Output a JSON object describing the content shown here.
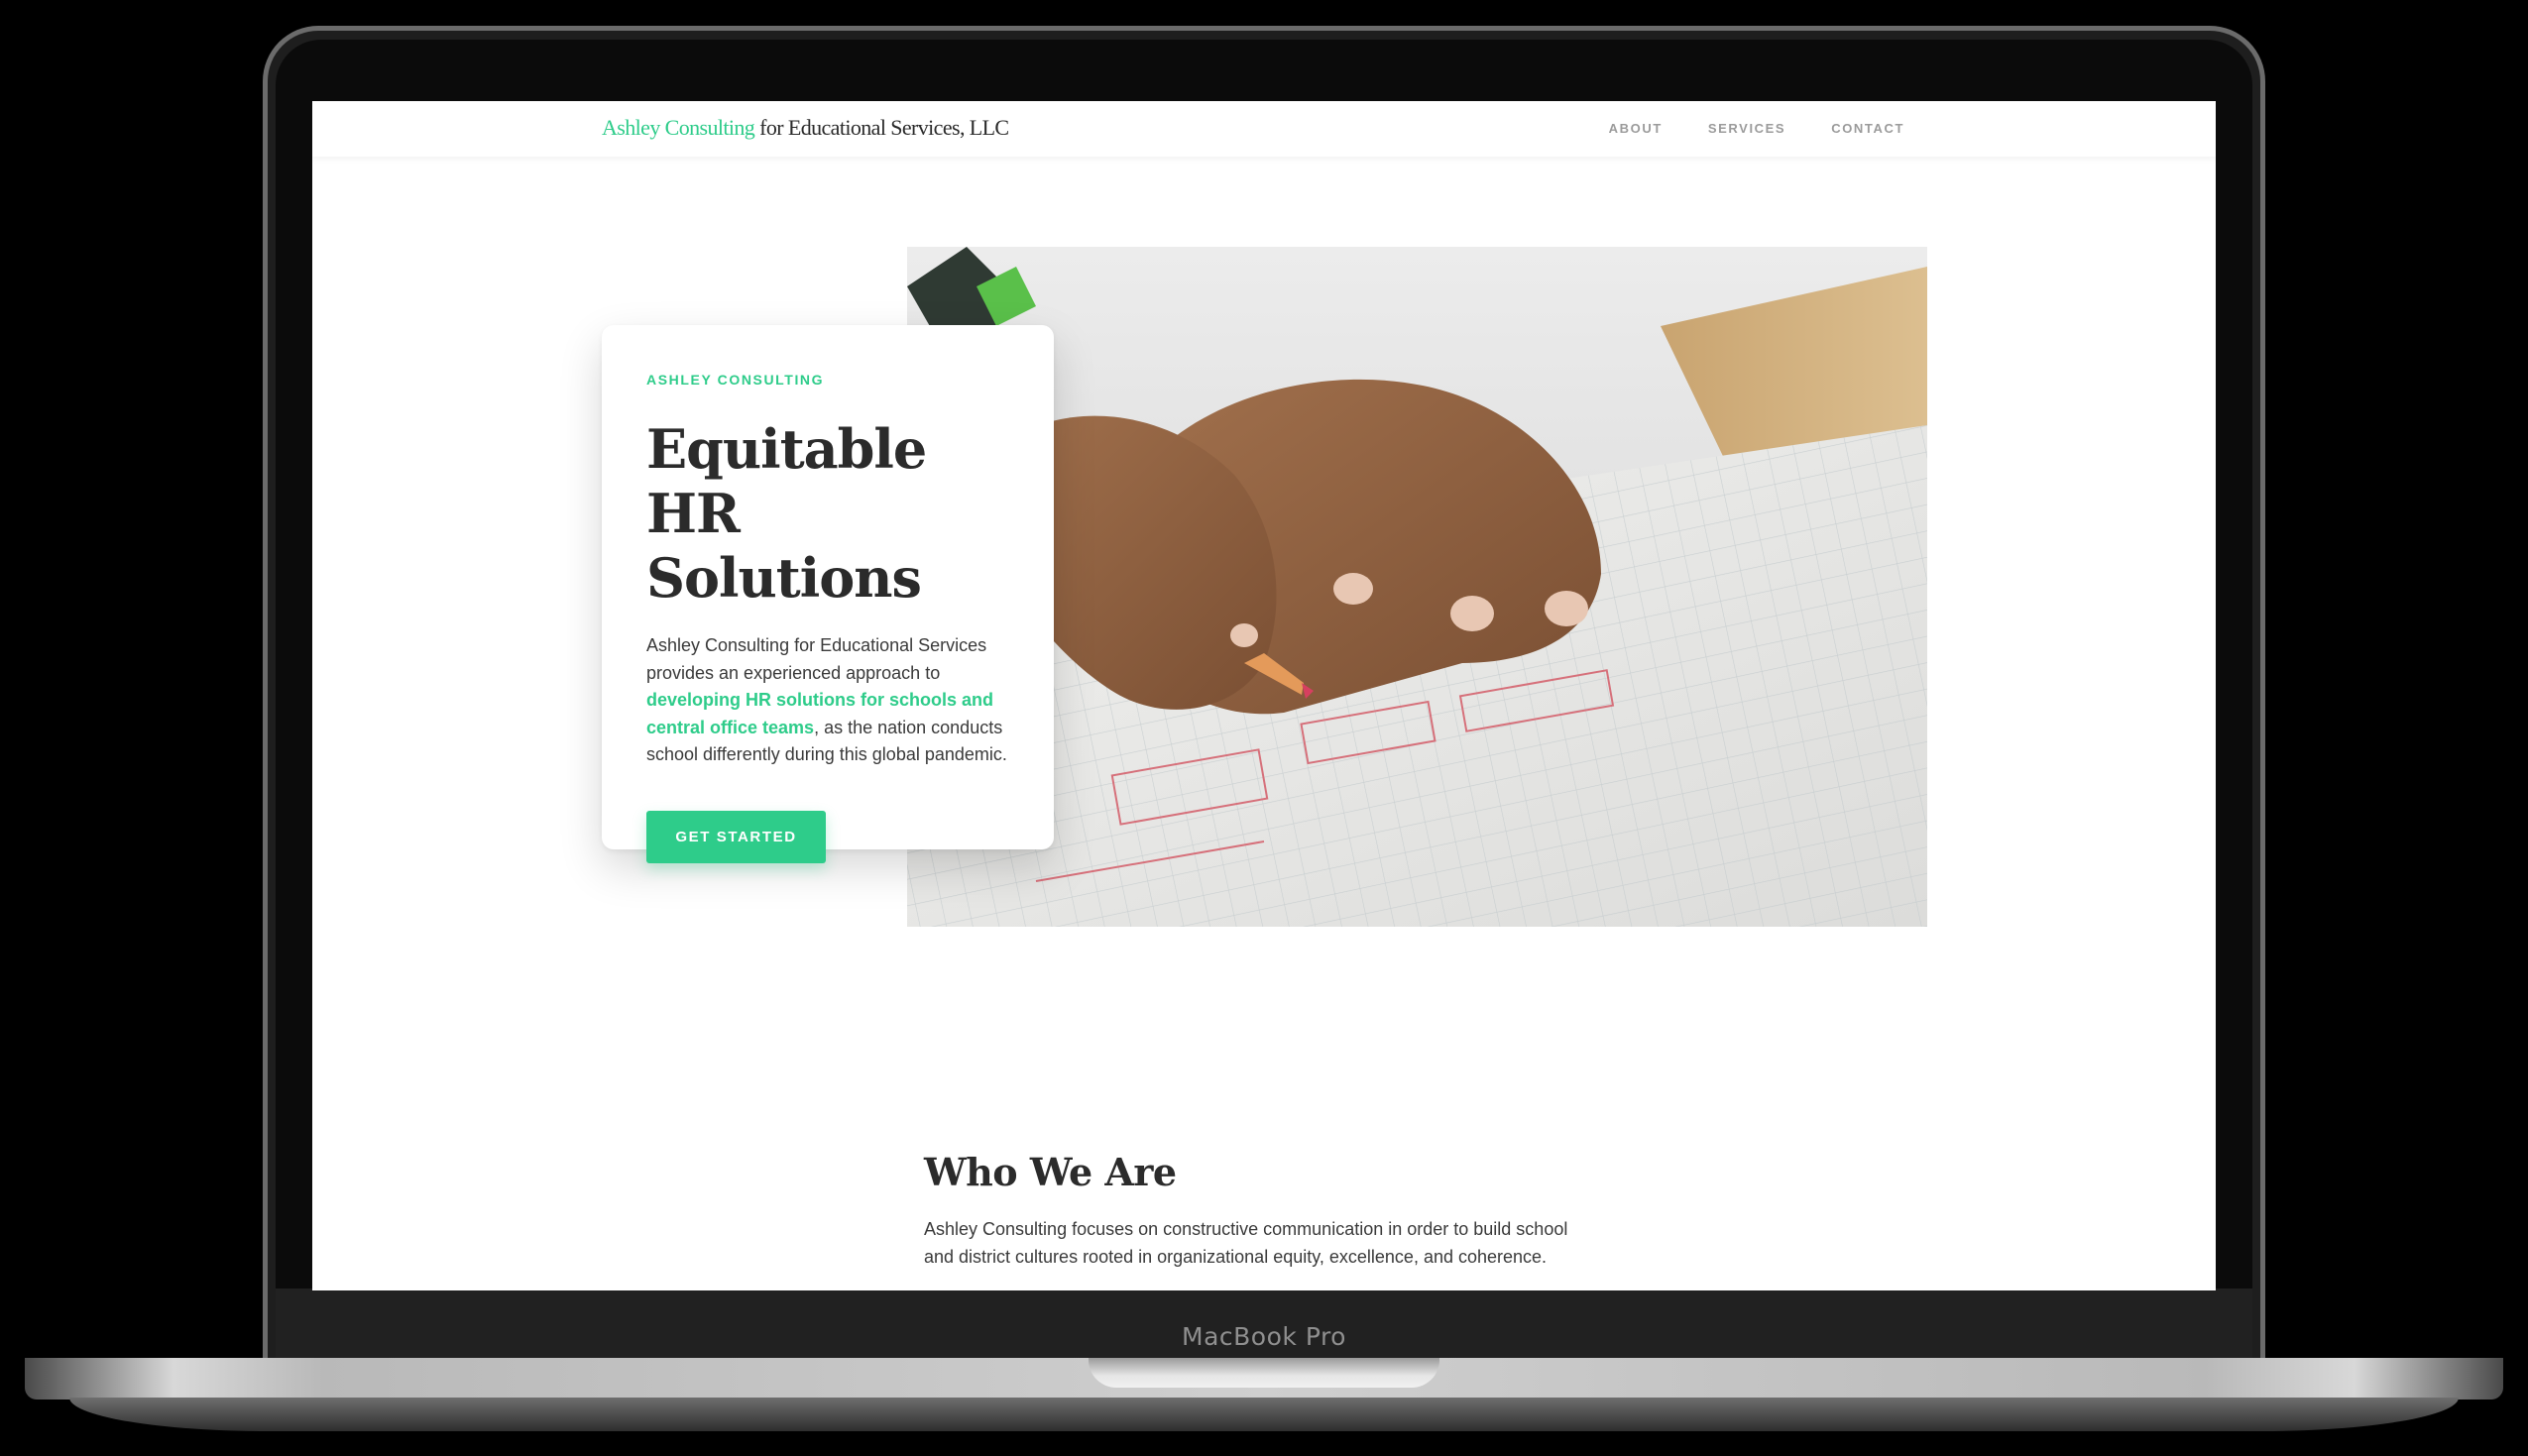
{
  "device": {
    "label": "MacBook Pro"
  },
  "nav": {
    "logo_green": "Ashley Consulting",
    "logo_rest": " for Educational Services, LLC",
    "links": [
      {
        "label": "ABOUT"
      },
      {
        "label": "SERVICES"
      },
      {
        "label": "CONTACT"
      }
    ]
  },
  "hero": {
    "eyebrow": "ASHLEY CONSULTING",
    "title_line1": "Equitable HR",
    "title_line2": "Solutions",
    "body_pre": "Ashley Consulting for Educational Services provides an experienced approach to ",
    "body_highlight": "developing HR solutions for schools and central office teams",
    "body_post": ", as the nation conducts school differently during this global pandemic.",
    "cta_label": "GET STARTED",
    "image_icon": "photo-child-writing-on-grid-paper"
  },
  "who": {
    "title": "Who We Are",
    "body": "Ashley Consulting focuses on constructive communication in order to build school and district cultures rooted in organizational equity, excellence, and coherence."
  },
  "colors": {
    "accent": "#2ecc8a",
    "text_dark": "#2b2b2b",
    "nav_link": "#9b9b9b",
    "frame": "#1e1e1e"
  }
}
